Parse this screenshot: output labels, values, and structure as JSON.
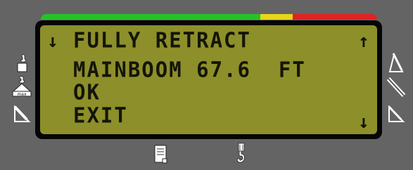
{
  "status_bar": {
    "colors": {
      "green": "#27c227",
      "yellow": "#e7d61c",
      "red": "#e02222"
    }
  },
  "screen": {
    "lines": [
      "FULLY RETRACT",
      "MAINBOOM 67.6  FT",
      "OK",
      "EXIT"
    ],
    "scroll_up_glyph": "↑",
    "scroll_down_glyph": "↓",
    "selection_glyph": "↓"
  },
  "left_icons": [
    "hook-weight-icon",
    "max-load-icon",
    "boom-angle-icon"
  ],
  "max_label": "max",
  "right_icons": [
    "boom-length-icon",
    "telescope-icon",
    "jib-angle-icon"
  ],
  "bottom_icons": [
    "document-icon",
    "hook-block-icon"
  ]
}
